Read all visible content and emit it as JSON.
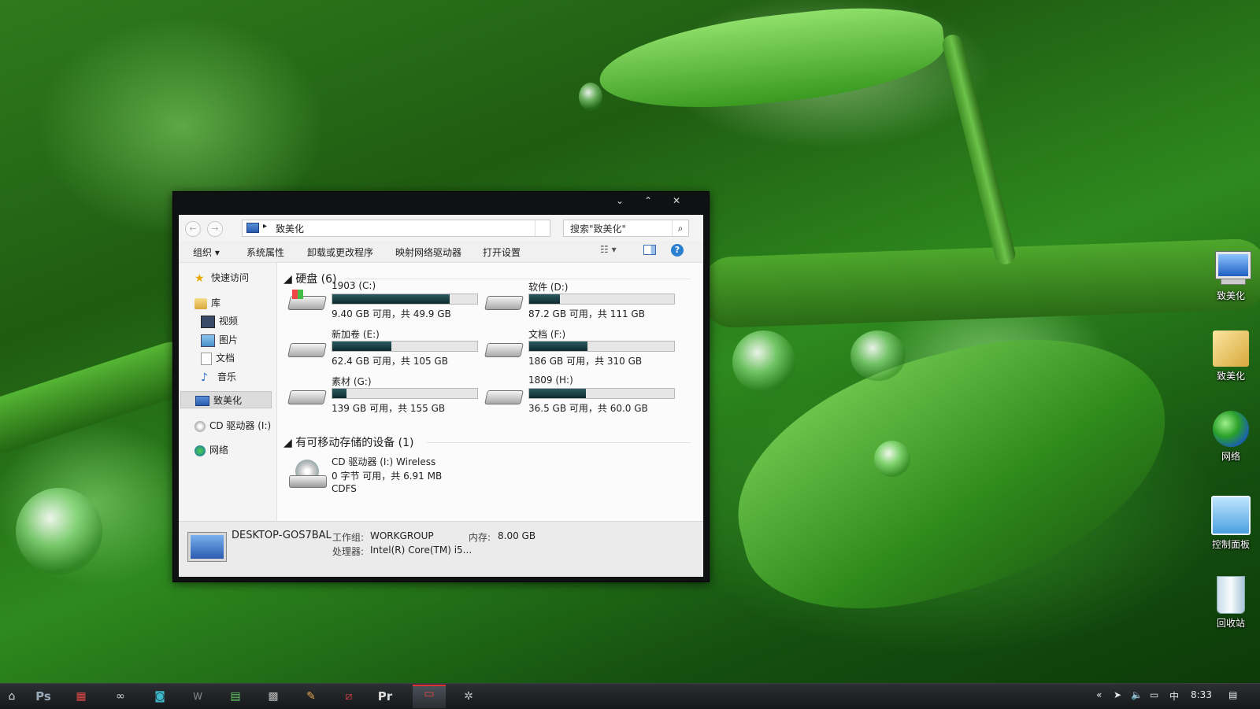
{
  "window": {
    "address": "致美化",
    "search_placeholder": "搜索\"致美化\"",
    "commands": {
      "organize": "组织",
      "system_properties": "系统属性",
      "uninstall": "卸载或更改程序",
      "map_drive": "映射网络驱动器",
      "open_settings": "打开设置"
    },
    "nav": {
      "quick_access": "快速访问",
      "library": "库",
      "videos": "视频",
      "pictures": "图片",
      "documents": "文档",
      "music": "音乐",
      "this_pc": "致美化",
      "cd_drive": "CD 驱动器 (I:)",
      "network": "网络"
    },
    "groups": {
      "hard_disks": "硬盘 (6)",
      "removable": "有可移动存储的设备 (1)"
    },
    "drives": [
      {
        "name": "1903 (C:)",
        "free_text": "9.40 GB 可用，共 49.9 GB",
        "used_fraction": 0.81
      },
      {
        "name": "软件 (D:)",
        "free_text": "87.2 GB 可用，共 111 GB",
        "used_fraction": 0.21
      },
      {
        "name": "新加卷 (E:)",
        "free_text": "62.4 GB 可用，共 105 GB",
        "used_fraction": 0.41
      },
      {
        "name": "文档 (F:)",
        "free_text": "186 GB 可用，共 310 GB",
        "used_fraction": 0.4
      },
      {
        "name": "素材 (G:)",
        "free_text": "139 GB 可用，共 155 GB",
        "used_fraction": 0.1
      },
      {
        "name": "1809 (H:)",
        "free_text": "36.5 GB 可用，共 60.0 GB",
        "used_fraction": 0.39
      }
    ],
    "cd": {
      "name": "CD 驱动器 (I:) Wireless",
      "free_text": "0 字节 可用，共 6.91 MB",
      "fs": "CDFS"
    },
    "details": {
      "computer": "DESKTOP-GOS7BAL",
      "workgroup_label": "工作组:",
      "workgroup": "WORKGROUP",
      "memory_label": "内存:",
      "memory": "8.00 GB",
      "cpu_label": "处理器:",
      "cpu": "Intel(R) Core(TM) i5..."
    }
  },
  "desktop_icons": [
    {
      "label": "致美化",
      "icon": "computer-icon"
    },
    {
      "label": "致美化",
      "icon": "user-folder-icon"
    },
    {
      "label": "网络",
      "icon": "network-icon"
    },
    {
      "label": "控制面板",
      "icon": "control-panel-icon"
    },
    {
      "label": "回收站",
      "icon": "recycle-bin-icon"
    }
  ],
  "taskbar": {
    "apps": [
      "start-icon",
      "photoshop-icon",
      "app-red-icon",
      "infinity-icon",
      "camera-icon",
      "word-icon",
      "file-icon",
      "video-icon",
      "pen-icon",
      "screenshot-icon",
      "premiere-icon",
      "explorer-icon",
      "settings-icon"
    ],
    "photoshop_label": "Ps",
    "premiere_label": "Pr",
    "chevron": "«",
    "ime": "中",
    "clock": "8:33"
  },
  "colors": {
    "accent": "#2a8ad4",
    "drive_bar": "#1b3f44",
    "taskbar": "#1e2124"
  }
}
